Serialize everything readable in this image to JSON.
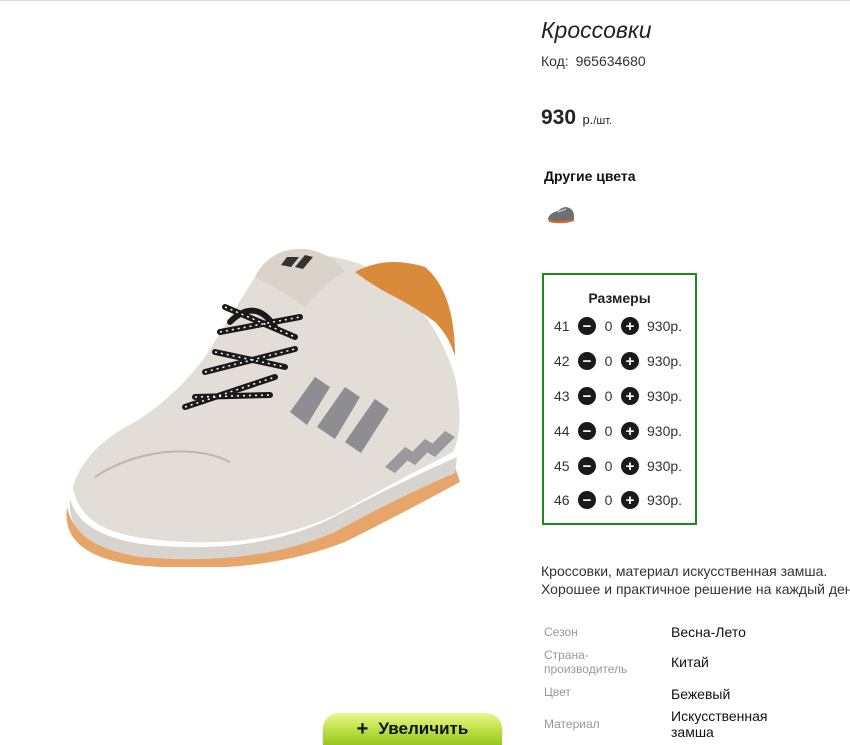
{
  "product": {
    "title": "Кроссовки",
    "code_label": "Код:",
    "code": "965634680",
    "price": "930",
    "currency": "р.",
    "unit": "/шт."
  },
  "other_colors": {
    "title": "Другие цвета",
    "thumb_icon": "sneaker-thumbnail-gray"
  },
  "sizes": {
    "title": "Размеры",
    "rows": [
      {
        "size": "41",
        "qty": "0",
        "price": "930р."
      },
      {
        "size": "42",
        "qty": "0",
        "price": "930р."
      },
      {
        "size": "43",
        "qty": "0",
        "price": "930р."
      },
      {
        "size": "44",
        "qty": "0",
        "price": "930р."
      },
      {
        "size": "45",
        "qty": "0",
        "price": "930р."
      },
      {
        "size": "46",
        "qty": "0",
        "price": "930р."
      }
    ],
    "minus_icon": "minus-circle-icon",
    "plus_icon": "plus-circle-icon",
    "border_color": "#1c8a1c"
  },
  "description": {
    "line1": "Кроссовки, материал искусственная замша.",
    "line2": "Хорошее и практичное решение на каждый день"
  },
  "specs": [
    {
      "label": "Сезон",
      "value": "Весна-Лето"
    },
    {
      "label": "Страна-\nпроизводитель",
      "value": "Китай"
    },
    {
      "label": "Цвет",
      "value": "Бежевый"
    },
    {
      "label": "Материал",
      "value": "Искусственная\nзамша"
    }
  ],
  "zoom": {
    "label": "Увеличить",
    "icon": "plus-icon"
  }
}
